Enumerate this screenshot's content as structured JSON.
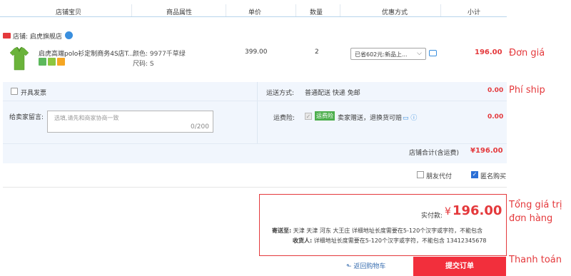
{
  "header": {
    "columns": [
      "店铺宝贝",
      "商品属性",
      "单价",
      "数量",
      "优惠方式",
      "小计"
    ]
  },
  "shop": {
    "label": "店铺: 启虎旗舰店"
  },
  "product": {
    "title": "启虎高端polo衫定制商务4S店T...",
    "attr_color": "颜色: 9977千草绿",
    "attr_size": "尺码: S",
    "price": "399.00",
    "quantity": "2",
    "promo": "已省602元:新品上...",
    "subtotal": "196.00"
  },
  "invoice": {
    "label": "开具发票"
  },
  "shipping": {
    "label": "运送方式:",
    "value": "普通配送 快递 免邮",
    "fee": "0.00"
  },
  "message": {
    "label": "给卖家留言:",
    "placeholder": "选填,请先和商家协商一致",
    "count": "0/200"
  },
  "insurance": {
    "label": "运费险:",
    "tag": "运费险",
    "text": "卖家赠送，退换货可赔",
    "fee": "0.00"
  },
  "shop_total": {
    "label": "店铺合计(含运费)",
    "value": "¥196.00"
  },
  "options": {
    "friend_pay": "朋友代付",
    "anonymous": "匿名购买"
  },
  "summary": {
    "paid_label": "实付款:",
    "currency": "¥",
    "paid_value": "196.00",
    "ship_to_label": "寄送至:",
    "ship_to_value": "天津 天津 河东 大王庄 详细地址长度需要在5-120个汉字或字符，不能包含",
    "receiver_label": "收货人:",
    "receiver_value": "详细地址长度需要在5-120个汉字或字符，不能包含 13412345678"
  },
  "actions": {
    "back": "返回购物车",
    "submit": "提交订单"
  },
  "annotations": {
    "unit_price": "Đơn giá",
    "shipping_fee": "Phí ship",
    "order_total_1": "Tổng giá trị",
    "order_total_2": "đơn hàng",
    "payment": "Thanh toán"
  },
  "colors": {
    "accent_red": "#e4393c",
    "submit_red": "#f22f3c",
    "blue_bg": "#f1f6fd",
    "link_blue": "#3a6fb0"
  }
}
